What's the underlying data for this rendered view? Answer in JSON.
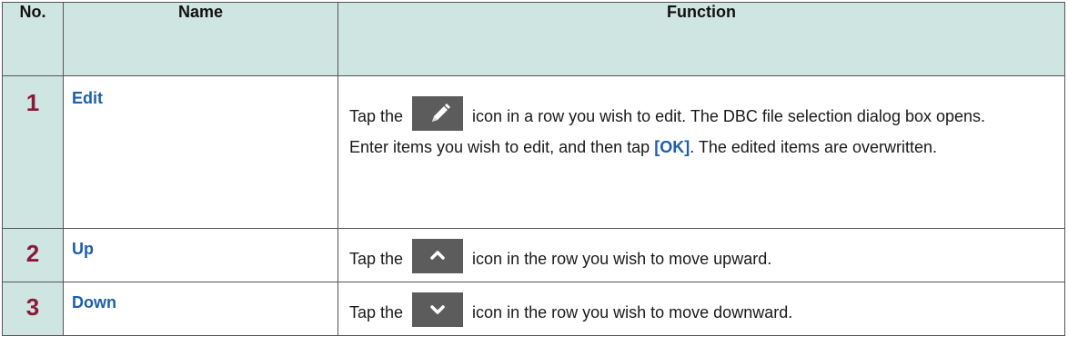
{
  "headers": {
    "no": "No.",
    "name": "Name",
    "function": "Function"
  },
  "rows": [
    {
      "no": "1",
      "name": "Edit",
      "icon": "pencil-icon",
      "text_before": "Tap the",
      "text_after": "icon in a row you wish to edit. The DBC file selection dialog box opens.",
      "line2_a": "Enter items you wish to edit, and then tap",
      "line2_b": "[OK]",
      "line2_c": ". The edited items are overwritten."
    },
    {
      "no": "2",
      "name": "Up",
      "icon": "chevron-up-icon",
      "text_before": "Tap the",
      "text_after": "icon in the row you wish to move upward."
    },
    {
      "no": "3",
      "name": "Down",
      "icon": "chevron-down-icon",
      "text_before": "Tap the",
      "text_after": "icon in the row you wish to move downward."
    }
  ],
  "colors": {
    "header_bg": "#cfe5e1",
    "number": "#8b1a3a",
    "name": "#1d5fab",
    "icon_bg": "#5c5c5c"
  }
}
